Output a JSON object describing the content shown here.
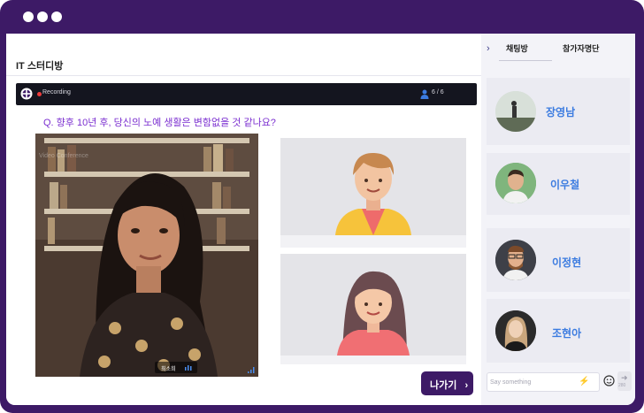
{
  "window": {
    "controls": [
      "close",
      "minimize",
      "maximize"
    ]
  },
  "room": {
    "title": "IT 스터디방"
  },
  "video": {
    "status": "Recording",
    "participant_count": "6 / 6",
    "question": "Q. 향후 10년 후, 당신의 노예 생활은 변함없을 것 같나요?",
    "watermark": "Video Conference",
    "speaker_name": "최소희"
  },
  "actions": {
    "exit_label": "나가기"
  },
  "sidebar": {
    "tabs": [
      {
        "label": "채팅방"
      },
      {
        "label": "참가자명단"
      }
    ],
    "participants": [
      {
        "name": "장영남"
      },
      {
        "name": "이우철"
      },
      {
        "name": "이정현"
      },
      {
        "name": "조현아"
      }
    ],
    "chat": {
      "placeholder": "Say something",
      "char_limit": "280"
    }
  },
  "colors": {
    "brand": "#3d1a66",
    "accent": "#7b2fd0",
    "name_link": "#3b7be0",
    "recording": "#ef3b3b"
  }
}
